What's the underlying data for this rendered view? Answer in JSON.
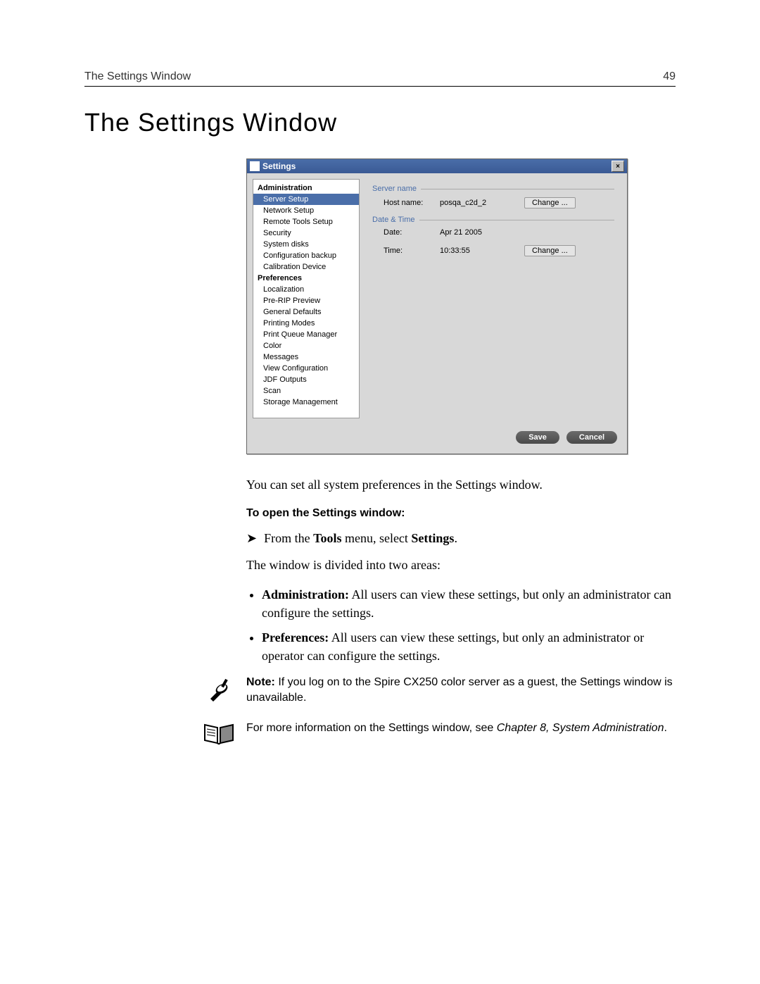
{
  "header": {
    "left": "The Settings Window",
    "page_number": "49"
  },
  "title": "The Settings Window",
  "settings_window": {
    "title": "Settings",
    "close_glyph": "×",
    "sidebar": {
      "cat1": "Administration",
      "items1": {
        "i0": "Server Setup",
        "i1": "Network Setup",
        "i2": "Remote Tools Setup",
        "i3": "Security",
        "i4": "System disks",
        "i5": "Configuration backup",
        "i6": "Calibration Device"
      },
      "cat2": "Preferences",
      "items2": {
        "i0": "Localization",
        "i1": "Pre-RIP Preview",
        "i2": "General Defaults",
        "i3": "Printing Modes",
        "i4": "Print Queue Manager",
        "i5": "Color",
        "i6": "Messages",
        "i7": "View Configuration",
        "i8": "JDF Outputs",
        "i9": "Scan",
        "i10": "Storage Management"
      }
    },
    "main": {
      "group1": "Server name",
      "hostname_label": "Host name:",
      "hostname_value": "posqa_c2d_2",
      "change1": "Change ...",
      "group2": "Date & Time",
      "date_label": "Date:",
      "date_value": "Apr 21 2005",
      "time_label": "Time:",
      "time_value": "10:33:55",
      "change2": "Change ..."
    },
    "footer": {
      "save": "Save",
      "cancel": "Cancel"
    }
  },
  "body": {
    "p1": "You can set all system preferences in the Settings window.",
    "subhead": "To open the Settings window:",
    "step_prefix": "From the ",
    "step_bold1": "Tools",
    "step_mid": " menu, select ",
    "step_bold2": "Settings",
    "step_suffix": ".",
    "p2": "The window is divided into two areas:",
    "bullet1_bold": "Administration:",
    "bullet1_rest": " All users can view these settings, but only an administrator can configure the settings.",
    "bullet2_bold": "Preferences:",
    "bullet2_rest": " All users can view these settings, but only an administrator or operator can configure the settings.",
    "note_bold": "Note:",
    "note_rest": "  If you log on to the Spire CX250 color server as a guest, the Settings window is unavailable.",
    "ref_pre": "For more information on the Settings window, see ",
    "ref_italic": "Chapter 8, System Administration",
    "ref_post": "."
  }
}
